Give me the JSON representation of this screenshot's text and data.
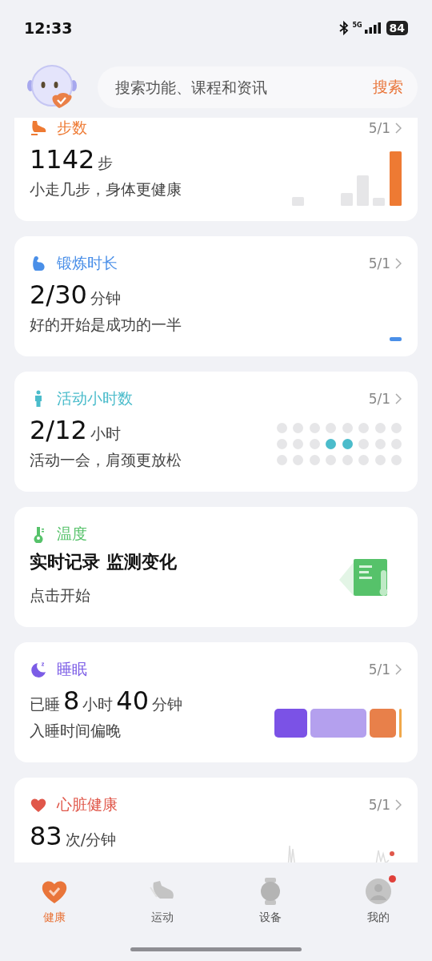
{
  "status_bar": {
    "time": "12:33",
    "network": "5G",
    "battery": "84"
  },
  "header": {
    "search": {
      "placeholder": "搜索功能、课程和资讯"
    },
    "search_button": "搜索"
  },
  "cards": [
    {
      "kind": "steps",
      "title": "步数",
      "color": "#ee7a33",
      "date": "5/1",
      "value_parts": [
        {
          "kind": "number",
          "text": "1142"
        },
        {
          "kind": "unit",
          "text": "步"
        }
      ],
      "subtitle": "小走几步，身体更健康",
      "graphic": {
        "kind": "week_bars"
      }
    },
    {
      "kind": "exercise",
      "title": "锻炼时长",
      "color": "#4a8fe8",
      "date": "5/1",
      "value_parts": [
        {
          "kind": "number",
          "text": "2/30"
        },
        {
          "kind": "unit",
          "text": "分钟"
        }
      ],
      "subtitle": "好的开始是成功的一半",
      "graphic": {
        "kind": "tiny_bar"
      }
    },
    {
      "kind": "activity",
      "title": "活动小时数",
      "color": "#4bbccb",
      "date": "5/1",
      "value_parts": [
        {
          "kind": "number",
          "text": "2/12"
        },
        {
          "kind": "unit",
          "text": "小时"
        }
      ],
      "subtitle": "活动一会，肩颈更放松",
      "graphic": {
        "kind": "dots",
        "dots": [
          {
            "active": false
          },
          {
            "active": false
          },
          {
            "active": false
          },
          {
            "active": false
          },
          {
            "active": false
          },
          {
            "active": false
          },
          {
            "active": false
          },
          {
            "active": false
          },
          {
            "active": false
          },
          {
            "active": false
          },
          {
            "active": false
          },
          {
            "active": true
          },
          {
            "active": true
          },
          {
            "active": false
          },
          {
            "active": false
          },
          {
            "active": false
          },
          {
            "active": false
          },
          {
            "active": false
          },
          {
            "active": false
          },
          {
            "active": false
          },
          {
            "active": false
          },
          {
            "active": false
          },
          {
            "active": false
          },
          {
            "active": false
          }
        ]
      }
    },
    {
      "kind": "temperature",
      "title": "温度",
      "color": "#56c26a",
      "value_parts": [
        {
          "kind": "headline",
          "text": "实时记录 监测变化"
        }
      ],
      "subtitle": "点击开始",
      "graphic": {
        "kind": "illustration"
      }
    },
    {
      "kind": "sleep",
      "title": "睡眠",
      "color": "#7b5ce6",
      "date": "5/1",
      "value_parts": [
        {
          "kind": "unit",
          "text": "已睡"
        },
        {
          "kind": "number",
          "text": "8"
        },
        {
          "kind": "unit",
          "text": "小时"
        },
        {
          "kind": "number",
          "text": "40"
        },
        {
          "kind": "unit",
          "text": "分钟"
        }
      ],
      "subtitle": "入睡时间偏晚",
      "graphic": {
        "kind": "segments",
        "segments": [
          {
            "color": "#7b52e6"
          },
          {
            "color": "#b4a0ee"
          },
          {
            "color": "#e8804a"
          },
          {
            "color": "#f0a84a"
          }
        ]
      }
    },
    {
      "kind": "heart",
      "title": "心脏健康",
      "color": "#e0574a",
      "date": "5/1",
      "value_parts": [
        {
          "kind": "number",
          "text": "83"
        },
        {
          "kind": "unit",
          "text": "次/分钟"
        }
      ],
      "graphic": {
        "kind": "sparkline"
      }
    }
  ],
  "tabs": [
    {
      "label": "健康",
      "selected": true,
      "badge": false
    },
    {
      "label": "运动",
      "selected": false,
      "badge": false
    },
    {
      "label": "设备",
      "selected": false,
      "badge": false
    },
    {
      "label": "我的",
      "selected": false,
      "badge": true
    }
  ]
}
